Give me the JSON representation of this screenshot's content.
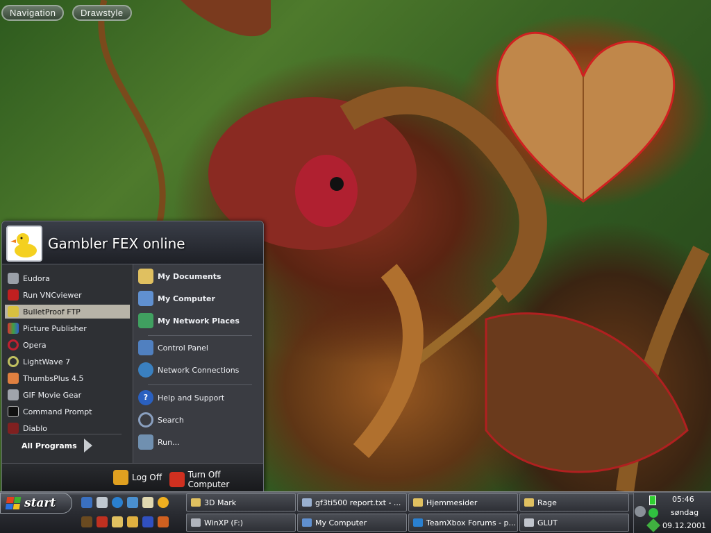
{
  "top_toolbar": {
    "navigation": "Navigation",
    "drawstyle": "Drawstyle"
  },
  "start_menu": {
    "user_name": "Gambler FEX online",
    "left_items": [
      {
        "label": "Eudora",
        "icon": "eudora-icon",
        "color": "#9aa0a8"
      },
      {
        "label": "Run VNCviewer",
        "icon": "vnc-icon",
        "color": "#c02020"
      },
      {
        "label": "BulletProof FTP",
        "icon": "ftp-icon",
        "color": "#d8c040",
        "selected": true
      },
      {
        "label": "Picture Publisher",
        "icon": "picture-publisher-icon",
        "color": "#40a040"
      },
      {
        "label": "Opera",
        "icon": "opera-icon",
        "color": "#c02030"
      },
      {
        "label": "LightWave 7",
        "icon": "lightwave-icon",
        "color": "#c0c060"
      },
      {
        "label": "ThumbsPlus 4.5",
        "icon": "thumbsplus-icon",
        "color": "#e08040"
      },
      {
        "label": "GIF Movie Gear",
        "icon": "gif-movie-gear-icon",
        "color": "#a0a4ac"
      },
      {
        "label": "Command Prompt",
        "icon": "command-prompt-icon",
        "color": "#111111"
      },
      {
        "label": "Diablo",
        "icon": "diablo-icon",
        "color": "#802020"
      }
    ],
    "all_programs": "All Programs",
    "right_items": [
      {
        "label": "My Documents",
        "icon": "my-documents-icon",
        "color": "#e0c060",
        "bold": true
      },
      {
        "label": "My Computer",
        "icon": "my-computer-icon",
        "color": "#6090d0",
        "bold": true
      },
      {
        "label": "My Network Places",
        "icon": "network-places-icon",
        "color": "#40a060",
        "bold": true
      },
      {
        "label": "Control Panel",
        "icon": "control-panel-icon",
        "color": "#5080c0",
        "bold": false
      },
      {
        "label": "Network Connections",
        "icon": "network-connections-icon",
        "color": "#3a80c0",
        "bold": false
      },
      {
        "label": "Help and Support",
        "icon": "help-icon",
        "color": "#2a60c0",
        "bold": false
      },
      {
        "label": "Search",
        "icon": "search-icon",
        "color": "#8aa0c0",
        "bold": false
      },
      {
        "label": "Run...",
        "icon": "run-icon",
        "color": "#7090b0",
        "bold": false
      }
    ],
    "log_off": "Log Off",
    "turn_off": "Turn Off Computer"
  },
  "taskbar": {
    "start_label": "start",
    "tasks": [
      {
        "label": "3D Mark",
        "icon": "folder-icon"
      },
      {
        "label": "gf3ti500 report.txt - ...",
        "icon": "notepad-icon"
      },
      {
        "label": "Hjemmesider",
        "icon": "folder-icon"
      },
      {
        "label": "Rage",
        "icon": "folder-icon"
      },
      {
        "label": "WinXP (F:)",
        "icon": "drive-icon"
      },
      {
        "label": "My Computer",
        "icon": "my-computer-icon"
      },
      {
        "label": "TeamXbox Forums - p...",
        "icon": "browser-icon"
      },
      {
        "label": "GLUT",
        "icon": "glut-icon"
      }
    ],
    "clock": {
      "time": "05:46",
      "day": "søndag",
      "date": "09.12.2001"
    }
  }
}
